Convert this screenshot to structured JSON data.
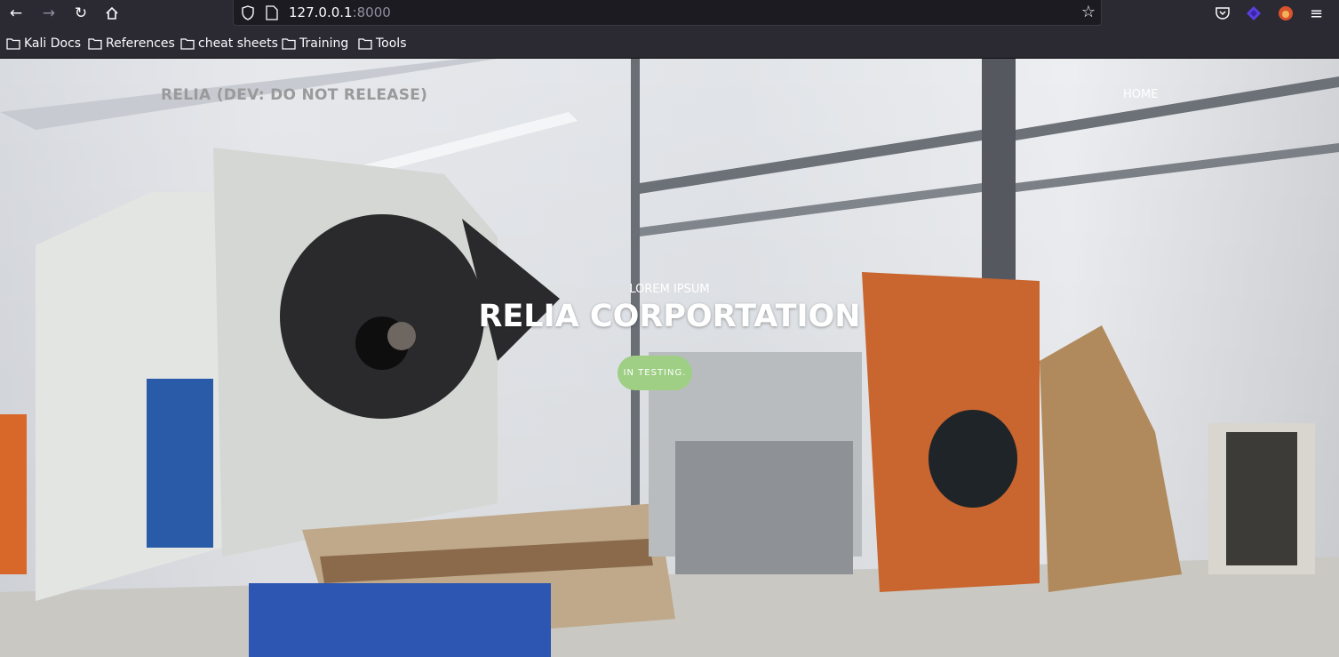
{
  "browser": {
    "url_host": "127.0.0.1",
    "url_port": ":8000",
    "bookmarks": [
      "Kali Docs",
      "References",
      "cheat sheets",
      "Training",
      "Tools"
    ]
  },
  "site": {
    "brand": "RELIA (DEV: DO NOT RELEASE)",
    "nav": {
      "home": "HOME"
    },
    "hero": {
      "subtitle": "LOREM IPSUM",
      "title": "RELIA CORPORTATION",
      "button": "IN TESTING."
    }
  },
  "colors": {
    "button": "#9ecf85",
    "toolbar": "#2b2a33"
  }
}
